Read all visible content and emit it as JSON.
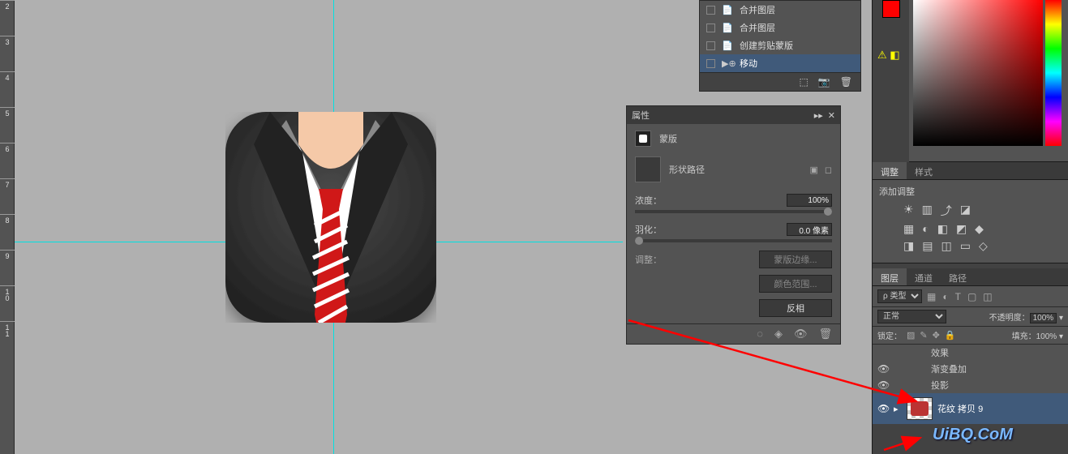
{
  "ruler": [
    "2",
    "3",
    "4",
    "5",
    "6",
    "7",
    "8",
    "9",
    "10",
    "11"
  ],
  "context_menu": {
    "items": [
      {
        "icon": "📄",
        "label": "合并图层"
      },
      {
        "icon": "📄",
        "label": "合并图层"
      },
      {
        "icon": "📄",
        "label": "创建剪贴蒙版"
      },
      {
        "icon": "▶",
        "label": "移动",
        "selected": true
      }
    ],
    "footer_icons": [
      "➕",
      "📷",
      "🗑"
    ]
  },
  "properties": {
    "title": "属性",
    "mask_label": "蒙版",
    "path_label": "形状路径",
    "density_label": "浓度：",
    "density_value": "100%",
    "feather_label": "羽化：",
    "feather_value": "0.0 像素",
    "adjust_label": "调整：",
    "mask_edge_btn": "蒙版边缘...",
    "color_range_btn": "颜色范围...",
    "invert_btn": "反相"
  },
  "adjust_tabs": {
    "tab1": "调整",
    "tab2": "样式"
  },
  "adjust_panel": {
    "title": "添加调整"
  },
  "layers_tabs": {
    "tab1": "图层",
    "tab2": "通道",
    "tab3": "路径"
  },
  "layers_panel": {
    "filter_label": "ρ 类型",
    "blend_mode": "正常",
    "opacity_label": "不透明度：",
    "opacity_value": "100%",
    "lock_label": "锁定：",
    "fill_label": "填充：",
    "fill_value": "100%"
  },
  "layers": {
    "fx_label": "效果",
    "grad_label": "渐变叠加",
    "shadow_label": "投影",
    "copy_label": "花纹 拷贝 9"
  },
  "watermark": "UiBQ.CoM"
}
